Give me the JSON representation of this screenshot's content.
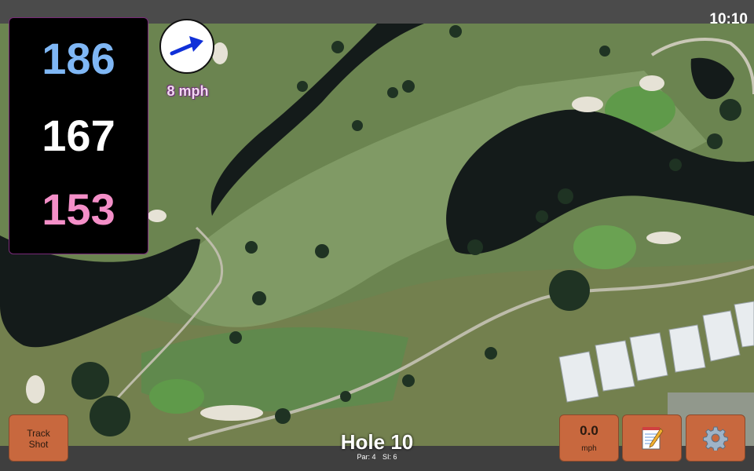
{
  "status": {
    "time": "10:10"
  },
  "distances": {
    "back": "186",
    "middle": "167",
    "front": "153"
  },
  "wind": {
    "speed_label": "8 mph",
    "icon": "wind-arrow-icon"
  },
  "hole": {
    "title": "Hole 10",
    "par": "Par: 4",
    "si": "SI: 6"
  },
  "buttons": {
    "track_line1": "Track",
    "track_line2": "Shot",
    "speed_value": "0.0",
    "speed_unit": "mph",
    "notes_icon": "notepad-icon",
    "settings_icon": "gear-icon"
  },
  "colors": {
    "back": "#7fb7f5",
    "middle": "#ffffff",
    "front": "#f48fc8",
    "button": "#c8683e"
  }
}
